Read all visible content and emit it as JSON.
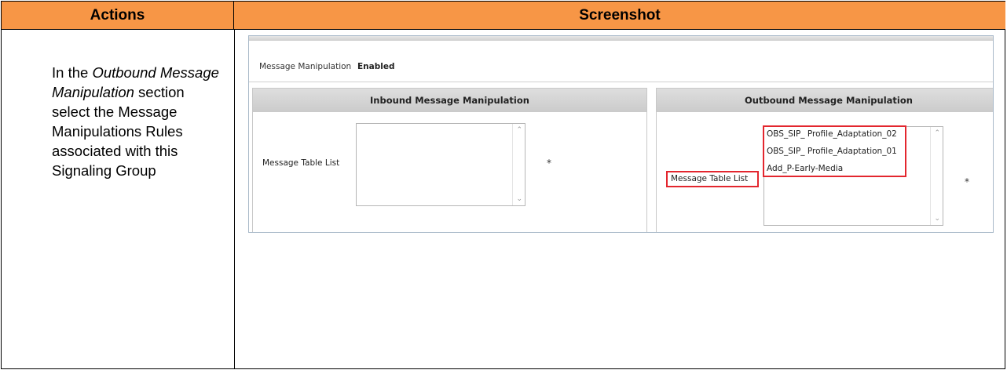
{
  "table": {
    "actions_header": "Actions",
    "screenshot_header": "Screenshot"
  },
  "instructions": {
    "part1": "In the ",
    "emphasis": "Outbound Message Manipulation",
    "part2": " section select the Message Manipulations Rules associated with this Signaling Group"
  },
  "screenshot": {
    "message_manipulation": {
      "label": "Message Manipulation",
      "value": "Enabled"
    },
    "inbound": {
      "title": "Inbound Message Manipulation",
      "field_label": "Message Table List",
      "required_mark": "*"
    },
    "outbound": {
      "title": "Outbound Message Manipulation",
      "field_label": "Message Table List",
      "required_mark": "*",
      "items": [
        "OBS_SIP_ Profile_Adaptation_02",
        "OBS_SIP_ Profile_Adaptation_01",
        "Add_P-Early-Media"
      ]
    },
    "highlight_color": "#e3262e"
  },
  "colors": {
    "header_bg": "#f79646"
  }
}
